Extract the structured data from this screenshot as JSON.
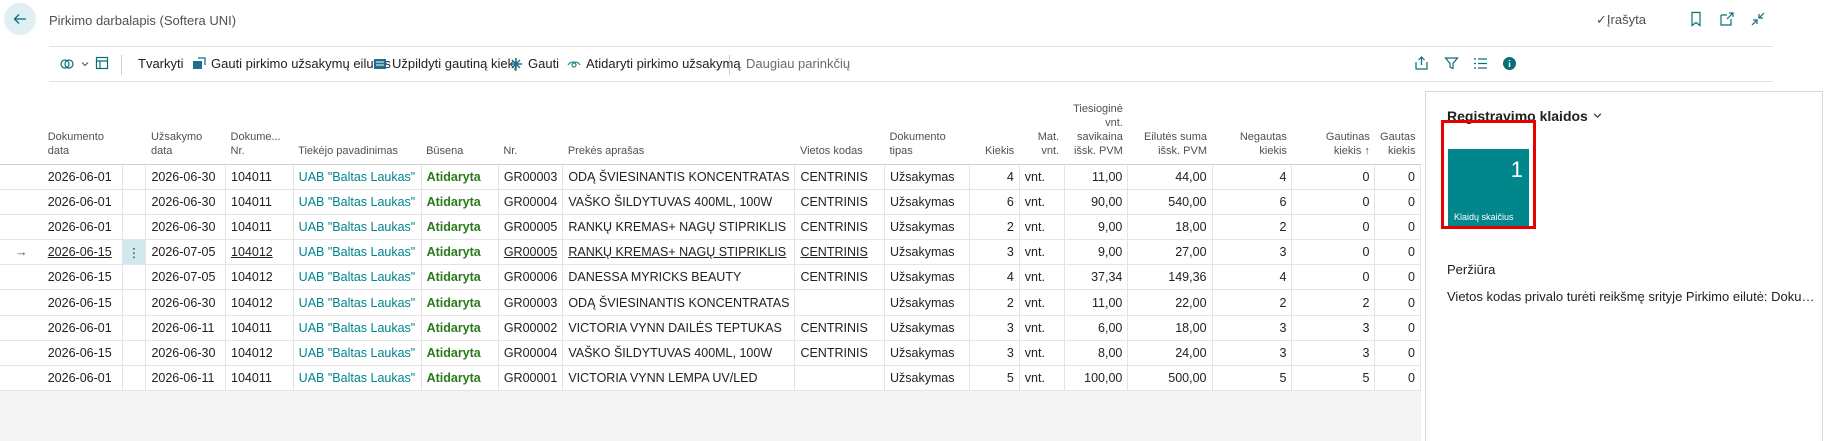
{
  "header": {
    "title": "Pirkimo darbalapis (Softera UNI)",
    "saved_label": "Įrašyta"
  },
  "actions": {
    "edit": "Tvarkyti",
    "get_lines": "Gauti pirkimo užsakymų eilutes",
    "fill_qty": "Užpildyti gautiną kiekį",
    "receive": "Gauti",
    "open_order": "Atidaryti pirkimo užsakymą",
    "more": "Daugiau parinkčių"
  },
  "columns": {
    "doc_date": "Dokumento data",
    "order_date": "Užsakymo data",
    "doc_no": "Dokume... Nr.",
    "vendor": "Tiekėjo pavadinimas",
    "status": "Būsena",
    "no": "Nr.",
    "desc": "Prekės aprašas",
    "location": "Vietos kodas",
    "doc_type": "Dokumento tipas",
    "qty": "Kiekis",
    "uom": "Mat. vnt.",
    "unit_cost": "Tiesioginė vnt. savikaina išsk. PVM",
    "line_amount": "Eilutės suma išsk. PVM",
    "not_received": "Negautas kiekis",
    "to_receive": "Gautinas kiekis ↑",
    "received": "Gautas kiekis"
  },
  "rows": [
    {
      "doc_date": "2026-06-01",
      "order_date": "2026-06-30",
      "doc_no": "104011",
      "vendor": "UAB \"Baltas Laukas\"",
      "status": "Atidaryta",
      "no": "GR00003",
      "desc": "ODĄ ŠVIESINANTIS KONCENTRATAS",
      "location": "CENTRINIS",
      "doc_type": "Užsakymas",
      "qty": "4",
      "uom": "vnt.",
      "unit_cost": "11,00",
      "line_amount": "44,00",
      "not_received": "4",
      "to_receive": "0",
      "received": "0"
    },
    {
      "doc_date": "2026-06-01",
      "order_date": "2026-06-30",
      "doc_no": "104011",
      "vendor": "UAB \"Baltas Laukas\"",
      "status": "Atidaryta",
      "no": "GR00004",
      "desc": "VAŠKO ŠILDYTUVAS 400ML, 100W",
      "location": "CENTRINIS",
      "doc_type": "Užsakymas",
      "qty": "6",
      "uom": "vnt.",
      "unit_cost": "90,00",
      "line_amount": "540,00",
      "not_received": "6",
      "to_receive": "0",
      "received": "0"
    },
    {
      "doc_date": "2026-06-01",
      "order_date": "2026-06-30",
      "doc_no": "104011",
      "vendor": "UAB \"Baltas Laukas\"",
      "status": "Atidaryta",
      "no": "GR00005",
      "desc": "RANKŲ KREMAS+ NAGŲ STIPRIKLIS",
      "location": "CENTRINIS",
      "doc_type": "Užsakymas",
      "qty": "2",
      "uom": "vnt.",
      "unit_cost": "9,00",
      "line_amount": "18,00",
      "not_received": "2",
      "to_receive": "0",
      "received": "0"
    },
    {
      "doc_date": "2026-06-15",
      "order_date": "2026-07-05",
      "doc_no": "104012",
      "vendor": "UAB \"Baltas Laukas\"",
      "status": "Atidaryta",
      "no": "GR00005",
      "desc": "RANKŲ KREMAS+ NAGŲ STIPRIKLIS",
      "location": "CENTRINIS",
      "doc_type": "Užsakymas",
      "qty": "3",
      "uom": "vnt.",
      "unit_cost": "9,00",
      "line_amount": "27,00",
      "not_received": "3",
      "to_receive": "0",
      "received": "0"
    },
    {
      "doc_date": "2026-06-15",
      "order_date": "2026-07-05",
      "doc_no": "104012",
      "vendor": "UAB \"Baltas Laukas\"",
      "status": "Atidaryta",
      "no": "GR00006",
      "desc": "DANESSA MYRICKS BEAUTY",
      "location": "CENTRINIS",
      "doc_type": "Užsakymas",
      "qty": "4",
      "uom": "vnt.",
      "unit_cost": "37,34",
      "line_amount": "149,36",
      "not_received": "4",
      "to_receive": "0",
      "received": "0"
    },
    {
      "doc_date": "2026-06-15",
      "order_date": "2026-06-30",
      "doc_no": "104012",
      "vendor": "UAB \"Baltas Laukas\"",
      "status": "Atidaryta",
      "no": "GR00003",
      "desc": "ODĄ ŠVIESINANTIS KONCENTRATAS",
      "location": "",
      "doc_type": "Užsakymas",
      "qty": "2",
      "uom": "vnt.",
      "unit_cost": "11,00",
      "line_amount": "22,00",
      "not_received": "2",
      "to_receive": "2",
      "received": "0"
    },
    {
      "doc_date": "2026-06-01",
      "order_date": "2026-06-11",
      "doc_no": "104011",
      "vendor": "UAB \"Baltas Laukas\"",
      "status": "Atidaryta",
      "no": "GR00002",
      "desc": "VICTORIA VYNN DAILĖS TEPTUKAS",
      "location": "CENTRINIS",
      "doc_type": "Užsakymas",
      "qty": "3",
      "uom": "vnt.",
      "unit_cost": "6,00",
      "line_amount": "18,00",
      "not_received": "3",
      "to_receive": "3",
      "received": "0"
    },
    {
      "doc_date": "2026-06-15",
      "order_date": "2026-06-30",
      "doc_no": "104012",
      "vendor": "UAB \"Baltas Laukas\"",
      "status": "Atidaryta",
      "no": "GR00004",
      "desc": "VAŠKO ŠILDYTUVAS 400ML, 100W",
      "location": "CENTRINIS",
      "doc_type": "Užsakymas",
      "qty": "3",
      "uom": "vnt.",
      "unit_cost": "8,00",
      "line_amount": "24,00",
      "not_received": "3",
      "to_receive": "3",
      "received": "0"
    },
    {
      "doc_date": "2026-06-01",
      "order_date": "2026-06-11",
      "doc_no": "104011",
      "vendor": "UAB \"Baltas Laukas\"",
      "status": "Atidaryta",
      "no": "GR00001",
      "desc": "VICTORIA VYNN LEMPA UV/LED",
      "location": "",
      "doc_type": "Užsakymas",
      "qty": "5",
      "uom": "vnt.",
      "unit_cost": "100,00",
      "line_amount": "500,00",
      "not_received": "5",
      "to_receive": "5",
      "received": "0"
    }
  ],
  "selected_row_index": 3,
  "row_marker": "→",
  "row_menu": "⋮",
  "factbox": {
    "title": "Registravimo klaidos",
    "tile_value": "1",
    "tile_label": "Klaidų skaičius",
    "preview_title": "Peržiūra",
    "preview_text": "Vietos kodas privalo turėti reikšmę srityje Pirkimo eilutė: Dokumento tipas"
  },
  "colors": {
    "accent": "#008489",
    "status_open": "#2a7a1b",
    "tile": "#00868b",
    "highlight": "#e60000"
  },
  "icons": [
    "back-arrow-icon",
    "bookmark-icon",
    "open-new-window-icon",
    "collapse-icon",
    "copilot-icon",
    "layout-icon",
    "receive-lines-icon",
    "fill-qty-icon",
    "receive-icon",
    "open-order-icon",
    "share-icon",
    "filter-icon",
    "list-icon",
    "info-icon"
  ]
}
